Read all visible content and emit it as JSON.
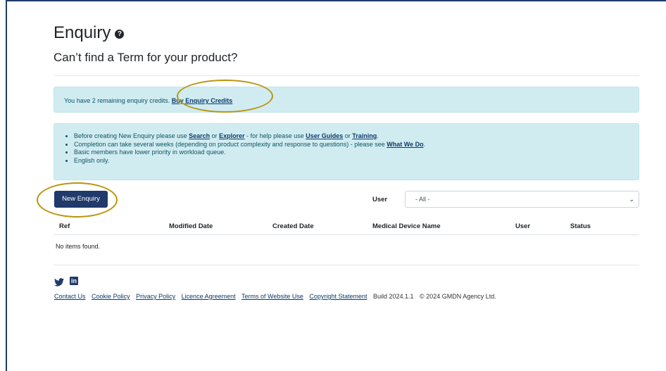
{
  "page": {
    "title": "Enquiry",
    "help_icon": "?",
    "subtitle": "Can’t find a Term for your product?"
  },
  "credits": {
    "text": "You have 2 remaining enquiry credits.",
    "link": "Buy Enquiry Credits"
  },
  "info": {
    "line1": {
      "pre": "Before creating New Enquiry please use ",
      "link1": "Search",
      "mid1": " or ",
      "link2": "Explorer",
      "mid2": " - for help please use ",
      "link3": "User Guides",
      "mid3": " or ",
      "link4": "Training",
      "post": "."
    },
    "line2": {
      "pre": "Completion can take several weeks (depending on product complexity and response to questions) - please see ",
      "link": "What We Do",
      "post": "."
    },
    "line3": "Basic members have lower priority in workload queue.",
    "line4": "English only."
  },
  "toolbar": {
    "new_enquiry": "New Enquiry",
    "user_label": "User",
    "user_selected": "- All -"
  },
  "table": {
    "columns": [
      "Ref",
      "Modified Date",
      "Created Date",
      "Medical Device Name",
      "User",
      "Status"
    ],
    "empty_text": "No items found."
  },
  "footer": {
    "social": [
      "twitter-icon",
      "linkedin-icon"
    ],
    "links": [
      "Contact Us",
      "Cookie Policy",
      "Privacy Policy",
      "Licence Agreement",
      "Terms of Website Use",
      "Copyright Statement"
    ],
    "build": "Build 2024.1.1",
    "copyright": "© 2024 GMDN Agency Ltd."
  },
  "colors": {
    "primary": "#1f3a6b",
    "alert_bg": "#d1ecf1",
    "annotation_ring": "#b8960c"
  }
}
